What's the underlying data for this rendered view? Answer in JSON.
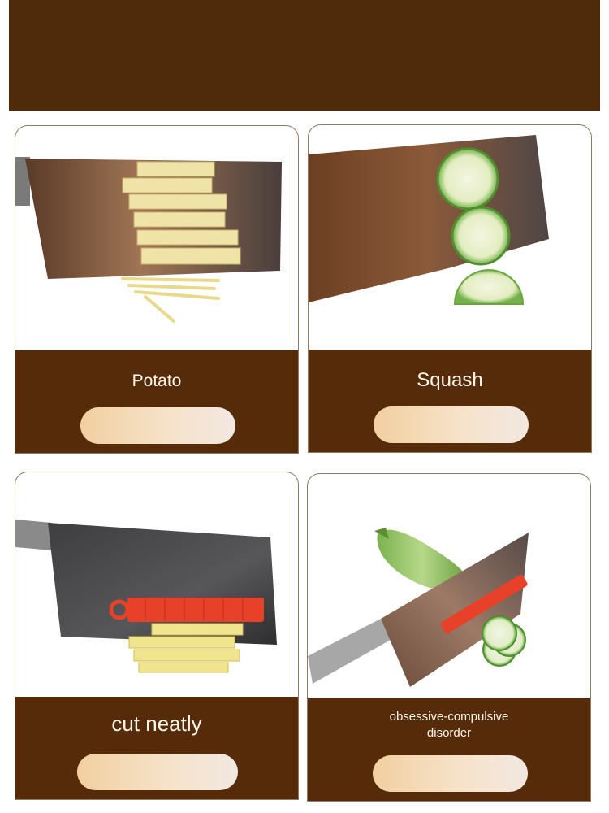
{
  "cards": [
    {
      "caption": "Potato",
      "icon": "knife-potato-strips-icon"
    },
    {
      "caption": "Squash",
      "icon": "knife-squash-slices-icon"
    },
    {
      "caption": "cut neatly",
      "icon": "knife-guard-potato-icon"
    },
    {
      "caption": "obsessive-compulsive\ndisorder",
      "icon": "knife-guard-zucchini-icon"
    }
  ],
  "colors": {
    "banner": "#4f2a0b",
    "footer": "#552b09",
    "caption_text": "#fff6ec",
    "pill_start": "#f2cfa0",
    "pill_end": "#f2e8e1",
    "guard_red": "#e8412a"
  }
}
